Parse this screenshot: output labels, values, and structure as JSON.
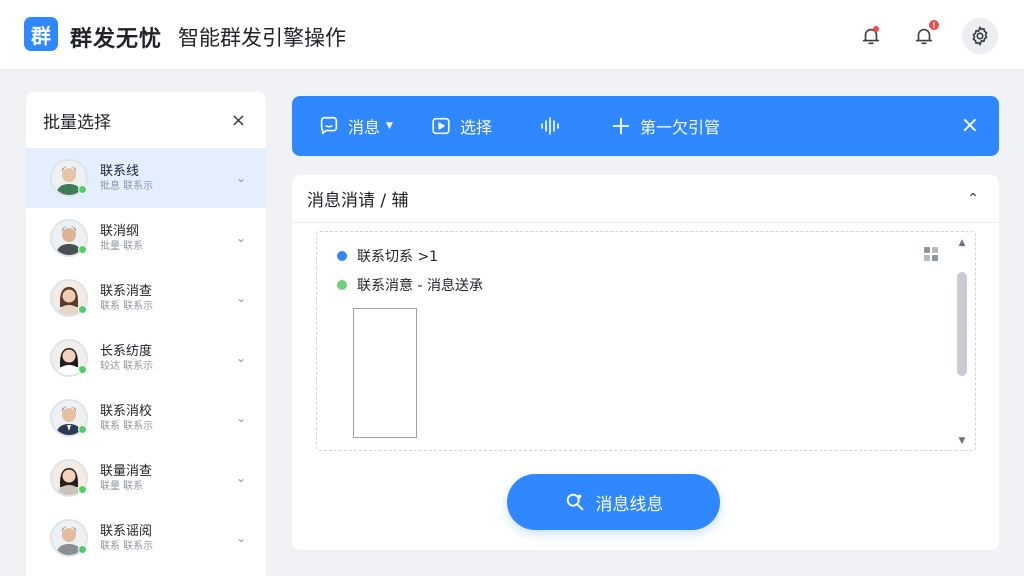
{
  "header": {
    "logo_char": "群",
    "app_name": "群发无忧",
    "subtitle": "智能群发引擎操作",
    "notification_badge": "!",
    "colors": {
      "accent": "#2f88ff",
      "alert": "#f04a4a"
    }
  },
  "sidebar": {
    "title": "批量选择",
    "close": "×",
    "contacts": [
      {
        "name": "联系线",
        "sub": "批息 联系示",
        "active": true
      },
      {
        "name": "联消纲",
        "sub": "批量·联系",
        "active": false
      },
      {
        "name": "联系消查",
        "sub": "联系 联系示",
        "active": false
      },
      {
        "name": "长系纺度",
        "sub": "较达 联系示",
        "active": false
      },
      {
        "name": "联系消校",
        "sub": "联系 联系示",
        "active": false
      },
      {
        "name": "联量消查",
        "sub": "联量 联系",
        "active": false
      },
      {
        "name": "联系谣阅",
        "sub": "联系 联系示",
        "active": false
      }
    ]
  },
  "toolbar": {
    "message_label": "消息",
    "select_label": "选择",
    "add_label": "第一欠引管",
    "close": "×"
  },
  "panel": {
    "title": "消息消请 / 辅",
    "lines": [
      {
        "text": "联系切系 >1",
        "color": "#2f88ff"
      },
      {
        "text": "联系消意 - 消息送承",
        "color": "#6fcf7a"
      }
    ],
    "send_label": "消息线息"
  }
}
